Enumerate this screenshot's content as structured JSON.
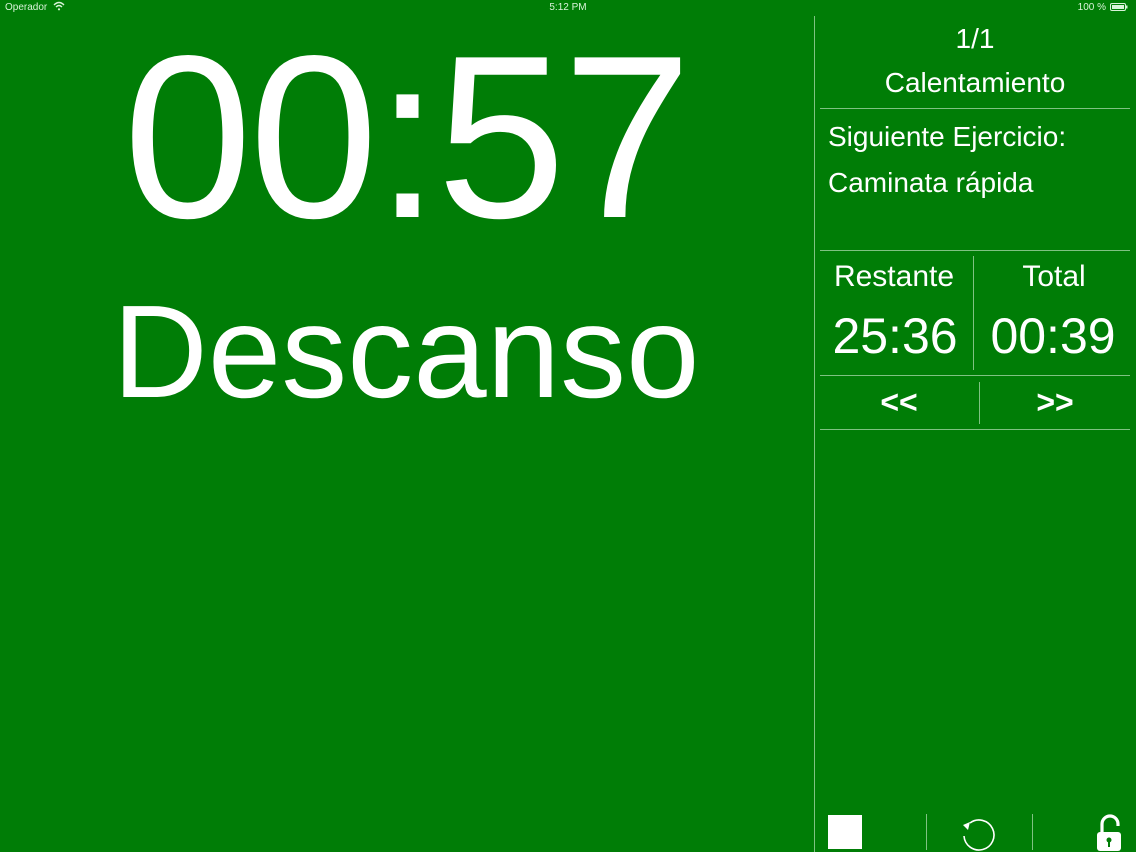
{
  "status_bar": {
    "carrier": "Operador",
    "wifi_icon": "wifi-icon",
    "time": "5:12 PM",
    "battery": "100 %",
    "battery_icon": "battery-icon"
  },
  "timer": {
    "time": "00:57",
    "state": "Descanso"
  },
  "panel": {
    "progress": "1/1",
    "phase": "Calentamiento",
    "next_label": "Siguiente Ejercicio:",
    "next_value": "Caminata rápida",
    "remaining_label": "Restante",
    "remaining_value": "25:36",
    "total_label": "Total",
    "total_value": "00:39",
    "prev_label": "<<",
    "next_button_label": ">>"
  },
  "toolbar": {
    "stop_icon": "stop-icon",
    "restart_icon": "restart-icon",
    "lock_icon": "unlock-icon"
  },
  "colors": {
    "background": "#007d06",
    "foreground": "#ffffff",
    "divider": "#7fc282"
  }
}
